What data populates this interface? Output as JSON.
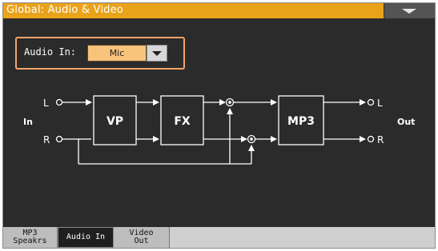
{
  "window": {
    "title": "Global: Audio & Video"
  },
  "audio_in": {
    "label": "Audio In:",
    "selected": "Mic"
  },
  "diagram": {
    "in_label": "In",
    "out_label": "Out",
    "left_ch": "L",
    "right_ch": "R",
    "vp_label": "VP",
    "fx_label": "FX",
    "mp3_label": "MP3",
    "out_left_ch": "L",
    "out_right_ch": "R"
  },
  "tabs": {
    "mp3_line1": "MP3",
    "mp3_line2": "Speakrs",
    "audio_in": "Audio In",
    "video_line1": "Video",
    "video_line2": "Out"
  }
}
